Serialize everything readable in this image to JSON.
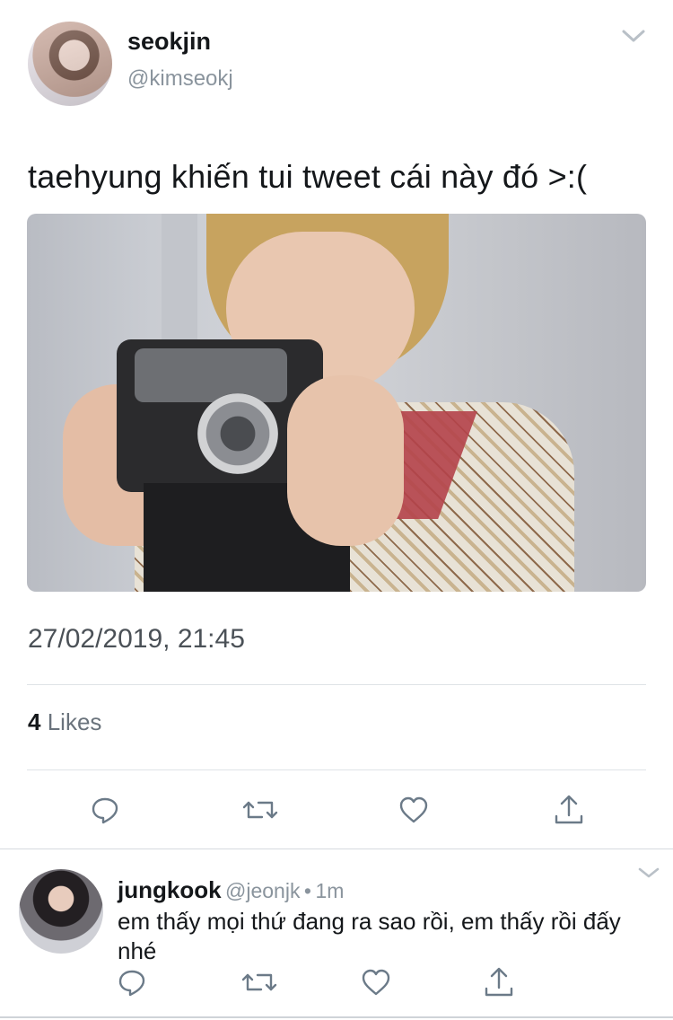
{
  "tweet": {
    "author": {
      "name": "seokjin",
      "handle": "@kimseokj"
    },
    "text": "taehyung khiến tui tweet cái này đó >:(",
    "media_alt": "",
    "timestamp": "27/02/2019, 21:45",
    "likes": {
      "count": "4",
      "label": "Likes"
    },
    "actions": [
      {
        "name": "reply-icon"
      },
      {
        "name": "retweet-icon"
      },
      {
        "name": "like-icon"
      },
      {
        "name": "share-icon"
      }
    ]
  },
  "reply": {
    "author": {
      "name": "jungkook",
      "handle": "@jeonjk"
    },
    "separator": "•",
    "time": "1m",
    "text": "em thấy mọi thứ đang ra sao rồi, em thấy rồi đấy nhé"
  },
  "colors": {
    "text": "#14171a",
    "secondary": "#8a949d",
    "icon": "#6b7a88",
    "divider": "#dfe3e7"
  }
}
